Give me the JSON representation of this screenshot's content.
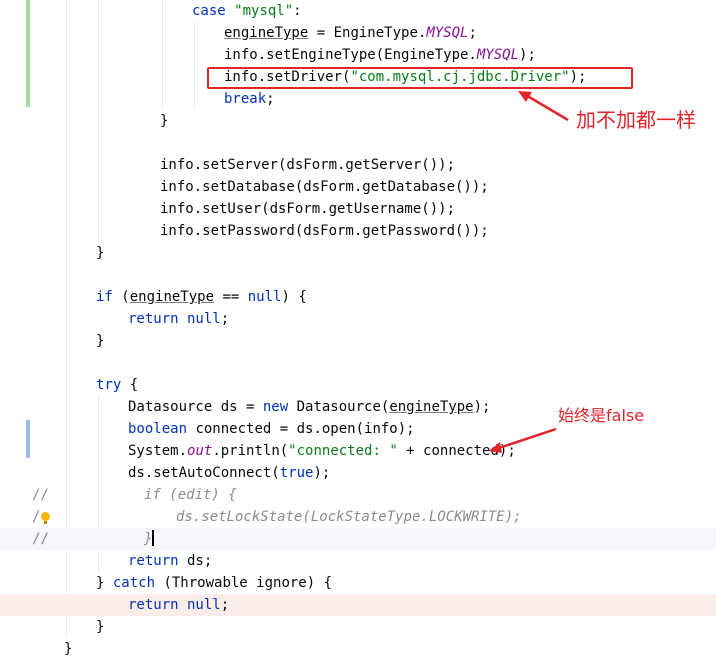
{
  "editor": {
    "lines": [
      {
        "parts": [
          [
            "kw",
            "case "
          ],
          [
            "str",
            "\"mysql\""
          ],
          [
            "p",
            ":"
          ]
        ]
      },
      {
        "parts": [
          [
            "ul",
            "engineType"
          ],
          [
            "p",
            " = EngineType."
          ],
          [
            "cst",
            "MYSQL"
          ],
          [
            "p",
            ";"
          ]
        ]
      },
      {
        "parts": [
          [
            "p",
            "info.setEngineType(EngineType."
          ],
          [
            "cst",
            "MYSQL"
          ],
          [
            "p",
            ");"
          ]
        ]
      },
      {
        "parts": [
          [
            "p",
            "info.setDriver("
          ],
          [
            "str",
            "\"com.mysql.cj.jdbc.Driver\""
          ],
          [
            "p",
            ");"
          ]
        ]
      },
      {
        "parts": [
          [
            "kw",
            "break"
          ],
          [
            "p",
            ";"
          ]
        ]
      },
      {
        "parts": [
          [
            "p",
            "}"
          ]
        ]
      },
      {
        "parts": []
      },
      {
        "parts": [
          [
            "p",
            "info.setServer(dsForm.getServer());"
          ]
        ]
      },
      {
        "parts": [
          [
            "p",
            "info.setDatabase(dsForm.getDatabase());"
          ]
        ]
      },
      {
        "parts": [
          [
            "p",
            "info.setUser(dsForm.getUsername());"
          ]
        ]
      },
      {
        "parts": [
          [
            "p",
            "info.setPassword(dsForm.getPassword());"
          ]
        ]
      },
      {
        "parts": [
          [
            "p",
            "}"
          ]
        ]
      },
      {
        "parts": []
      },
      {
        "parts": [
          [
            "kw",
            "if "
          ],
          [
            "p",
            "("
          ],
          [
            "ul",
            "engineType"
          ],
          [
            "p",
            " == "
          ],
          [
            "kw",
            "null"
          ],
          [
            "p",
            ") {"
          ]
        ]
      },
      {
        "parts": [
          [
            "kw",
            "return null"
          ],
          [
            "p",
            ";"
          ]
        ]
      },
      {
        "parts": [
          [
            "p",
            "}"
          ]
        ]
      },
      {
        "parts": []
      },
      {
        "parts": [
          [
            "kw",
            "try"
          ],
          [
            "p",
            " {"
          ]
        ]
      },
      {
        "parts": [
          [
            "p",
            "Datasource ds = "
          ],
          [
            "kw",
            "new"
          ],
          [
            "p",
            " Datasource("
          ],
          [
            "ul",
            "engineType"
          ],
          [
            "p",
            ");"
          ]
        ]
      },
      {
        "parts": [
          [
            "kw",
            "boolean"
          ],
          [
            "p",
            " connected = ds.open(info);"
          ]
        ]
      },
      {
        "parts": [
          [
            "p",
            "System."
          ],
          [
            "stat",
            "out"
          ],
          [
            "p",
            ".println("
          ],
          [
            "str",
            "\"connected: \""
          ],
          [
            "p",
            " + connected);"
          ]
        ]
      },
      {
        "parts": [
          [
            "p",
            "ds.setAutoConnect("
          ],
          [
            "kw",
            "true"
          ],
          [
            "p",
            ");"
          ]
        ]
      },
      {
        "parts": [
          [
            "cm",
            "if (edit) {"
          ]
        ],
        "gutter": "//"
      },
      {
        "parts": [
          [
            "cm",
            "ds.setLockState(LockStateType.LOCKWRITE);"
          ]
        ],
        "gutter": "/"
      },
      {
        "parts": [
          [
            "cm",
            "}"
          ]
        ],
        "gutter": "//"
      },
      {
        "parts": [
          [
            "kw",
            "return"
          ],
          [
            "p",
            " ds;"
          ]
        ]
      },
      {
        "parts": [
          [
            "p",
            "} "
          ],
          [
            "kw",
            "catch"
          ],
          [
            "p",
            " (Throwable ignore) {"
          ]
        ]
      },
      {
        "parts": [
          [
            "kw",
            "return null"
          ],
          [
            "p",
            ";"
          ]
        ]
      },
      {
        "parts": [
          [
            "p",
            "}"
          ]
        ]
      },
      {
        "parts": [
          [
            "p",
            "}"
          ]
        ]
      }
    ]
  },
  "annotations": {
    "note_driver": "加不加都一样",
    "note_connected": "始终是false",
    "color": "#e2252b"
  },
  "icons": {
    "intention": "lightbulb-icon"
  }
}
